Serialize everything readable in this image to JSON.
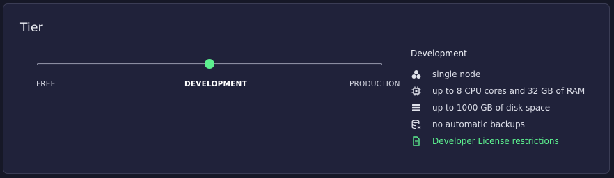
{
  "tier": {
    "title": "Tier",
    "slider": {
      "options": [
        "FREE",
        "DEVELOPMENT",
        "PRODUCTION"
      ],
      "selected": "DEVELOPMENT",
      "selected_index": 1,
      "accent_color": "#5cf08f"
    },
    "details": {
      "title": "Development",
      "features": [
        {
          "icon": "nodes-icon",
          "text": "single node"
        },
        {
          "icon": "cpu-icon",
          "text": "up to 8 CPU cores and 32 GB of RAM"
        },
        {
          "icon": "storage-icon",
          "text": "up to 1000 GB of disk space"
        },
        {
          "icon": "no-backup-icon",
          "text": "no automatic backups"
        },
        {
          "icon": "document-icon",
          "text": "Developer License restrictions",
          "link": true,
          "color": "#5cf08f"
        }
      ]
    }
  }
}
